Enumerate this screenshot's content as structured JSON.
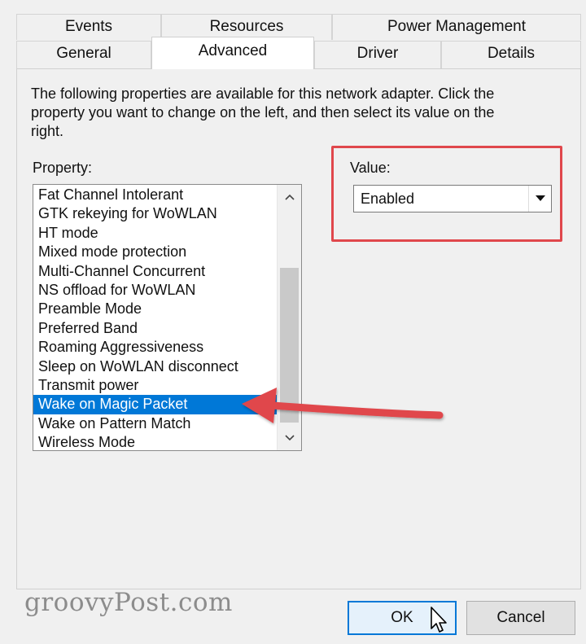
{
  "tabs": {
    "row1": [
      {
        "label": "Events"
      },
      {
        "label": "Resources"
      },
      {
        "label": "Power Management"
      }
    ],
    "row2": [
      {
        "label": "General"
      },
      {
        "label": "Advanced"
      },
      {
        "label": "Driver"
      },
      {
        "label": "Details"
      }
    ],
    "active": "Advanced"
  },
  "description": "The following properties are available for this network adapter. Click the property you want to change on the left, and then select its value on the right.",
  "property": {
    "label": "Property:",
    "items": [
      "Fat Channel Intolerant",
      "GTK rekeying for WoWLAN",
      "HT mode",
      "Mixed mode protection",
      "Multi-Channel Concurrent",
      "NS offload for WoWLAN",
      "Preamble Mode",
      "Preferred Band",
      "Roaming Aggressiveness",
      "Sleep on WoWLAN disconnect",
      "Transmit power",
      "Wake on Magic Packet",
      "Wake on Pattern Match",
      "Wireless Mode"
    ],
    "selected": "Wake on Magic Packet"
  },
  "value": {
    "label": "Value:",
    "selected": "Enabled"
  },
  "buttons": {
    "ok": "OK",
    "cancel": "Cancel"
  },
  "watermark": "groovyPost.com",
  "colors": {
    "selection": "#0078d7",
    "annotation": "#e0474c",
    "dialog_bg": "#f0f0f0"
  },
  "icons": {
    "scroll_up": "chevron-up-icon",
    "scroll_down": "chevron-down-icon",
    "dropdown": "caret-down-icon",
    "pointer": "mouse-cursor-icon"
  }
}
